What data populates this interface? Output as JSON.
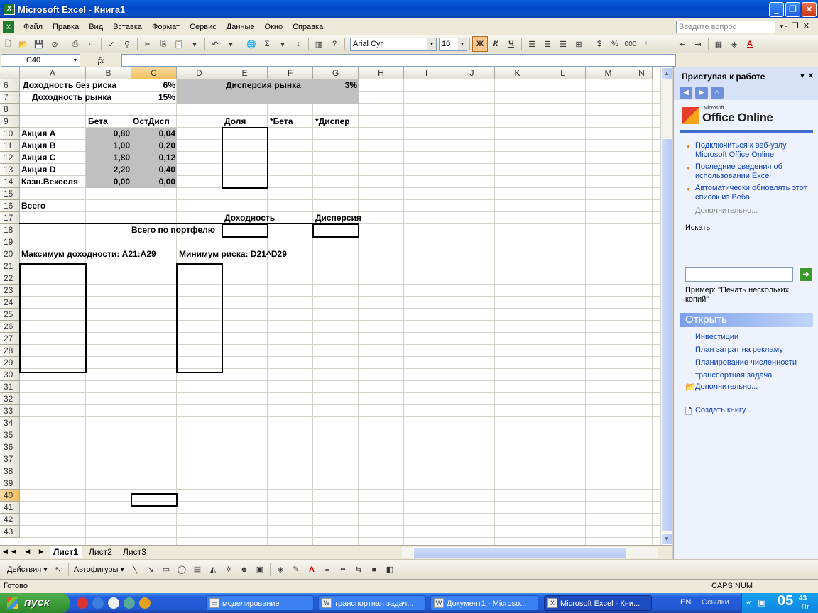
{
  "window": {
    "title": "Microsoft Excel - Книга1"
  },
  "menu": {
    "items": [
      "Файл",
      "Правка",
      "Вид",
      "Вставка",
      "Формат",
      "Сервис",
      "Данные",
      "Окно",
      "Справка"
    ],
    "ask_placeholder": "Введите вопрос"
  },
  "toolbar": {
    "font": "Arial Cyr",
    "size": "10",
    "bold": "Ж",
    "italic": "К",
    "underline": "Ч",
    "percent": "%",
    "thousands": "000",
    "autosum": "Σ",
    "font_color": "A"
  },
  "formula": {
    "namebox": "C40",
    "fx": "fx"
  },
  "columns": [
    "A",
    "B",
    "C",
    "D",
    "E",
    "F",
    "G",
    "H",
    "I",
    "J",
    "K",
    "L",
    "M",
    "N"
  ],
  "rows": [
    "6",
    "7",
    "8",
    "9",
    "10",
    "11",
    "12",
    "13",
    "14",
    "15",
    "16",
    "17",
    "18",
    "19",
    "20",
    "21",
    "22",
    "23",
    "24",
    "25",
    "26",
    "27",
    "28",
    "29",
    "30",
    "31",
    "32",
    "33",
    "34",
    "35",
    "36",
    "37",
    "38",
    "39",
    "40",
    "41",
    "42",
    "43"
  ],
  "cells": {
    "a6": "Доходность без риска",
    "c6": "6%",
    "e6": "Дисперсия рынка",
    "g6": "3%",
    "a7": "Доходность рынка",
    "c7": "15%",
    "b9": "Бета",
    "c9": "ОстДисп",
    "e9": "Доля",
    "f9": "*Бета",
    "g9": "*Диспер",
    "a10": "Акция A",
    "b10": "0,80",
    "c10": "0,04",
    "a11": "Акция B",
    "b11": "1,00",
    "c11": "0,20",
    "a12": "Акция C",
    "b12": "1,80",
    "c12": "0,12",
    "a13": "Акция D",
    "b13": "2,20",
    "c13": "0,40",
    "a14": "Казн.Векселя",
    "b14": "0,00",
    "c14": "0,00",
    "a16": "Всего",
    "e17": "Доходность",
    "g17": "Дисперсия",
    "c18": "Всего по портфелю",
    "a20": "Максимум доходности: A21:A29",
    "d20": "Минимум риска: D21^D29"
  },
  "sheets": [
    "Лист1",
    "Лист2",
    "Лист3"
  ],
  "drawing": {
    "actions": "Действия",
    "autoshapes": "Автофигуры"
  },
  "status": {
    "left": "Готово",
    "caps": "CAPS NUM"
  },
  "taskpane": {
    "title": "Приступая к работе",
    "logo_small": "Microsoft",
    "logo_big": "Office Online",
    "links": [
      "Подключиться к веб-узлу Microsoft Office Online",
      "Последние сведения об использовании Excel",
      "Автоматически обновлять этот список из Веба"
    ],
    "more": "Дополнительно...",
    "search_label": "Искать:",
    "example": "Пример: \"Печать нескольких копий\"",
    "open_title": "Открыть",
    "files": [
      "Инвестиции",
      "План затрат на рекламу",
      "Планирование численности",
      "транспортная задача"
    ],
    "open_more": "Дополнительно...",
    "create": "Создать книгу..."
  },
  "taskbar": {
    "start": "пуск",
    "tasks": [
      "моделирование",
      "транспортная задач...",
      "Документ1 - Microso...",
      "Microsoft Excel - Кни..."
    ],
    "lang": "EN",
    "links": "Ссылки",
    "clock_hour": "05",
    "clock_min": "43",
    "clock_day": "Пт"
  }
}
